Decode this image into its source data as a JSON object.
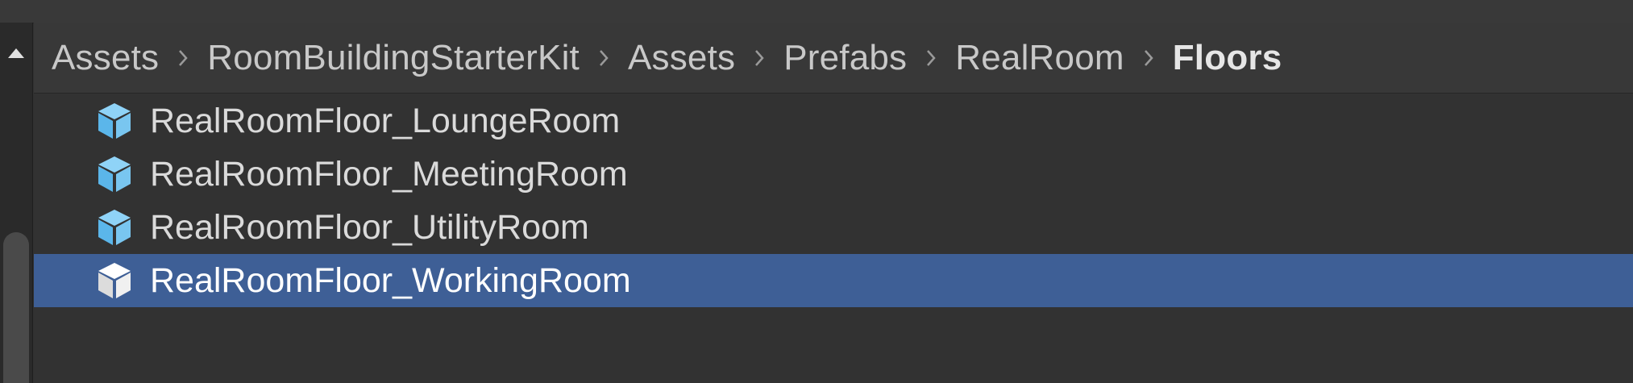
{
  "breadcrumb": {
    "items": [
      "Assets",
      "RoomBuildingStarterKit",
      "Assets",
      "Prefabs",
      "RealRoom",
      "Floors"
    ]
  },
  "files": [
    {
      "label": "RealRoomFloor_LoungeRoom",
      "icon": "prefab-cube-icon",
      "selected": false
    },
    {
      "label": "RealRoomFloor_MeetingRoom",
      "icon": "prefab-cube-icon",
      "selected": false
    },
    {
      "label": "RealRoomFloor_UtilityRoom",
      "icon": "prefab-cube-icon",
      "selected": false
    },
    {
      "label": "RealRoomFloor_WorkingRoom",
      "icon": "prefab-cube-icon",
      "selected": true
    }
  ],
  "colors": {
    "selection": "#3e5f96",
    "prefab_icon": "#6ec3f2",
    "prefab_icon_selected": "#ffffff"
  }
}
